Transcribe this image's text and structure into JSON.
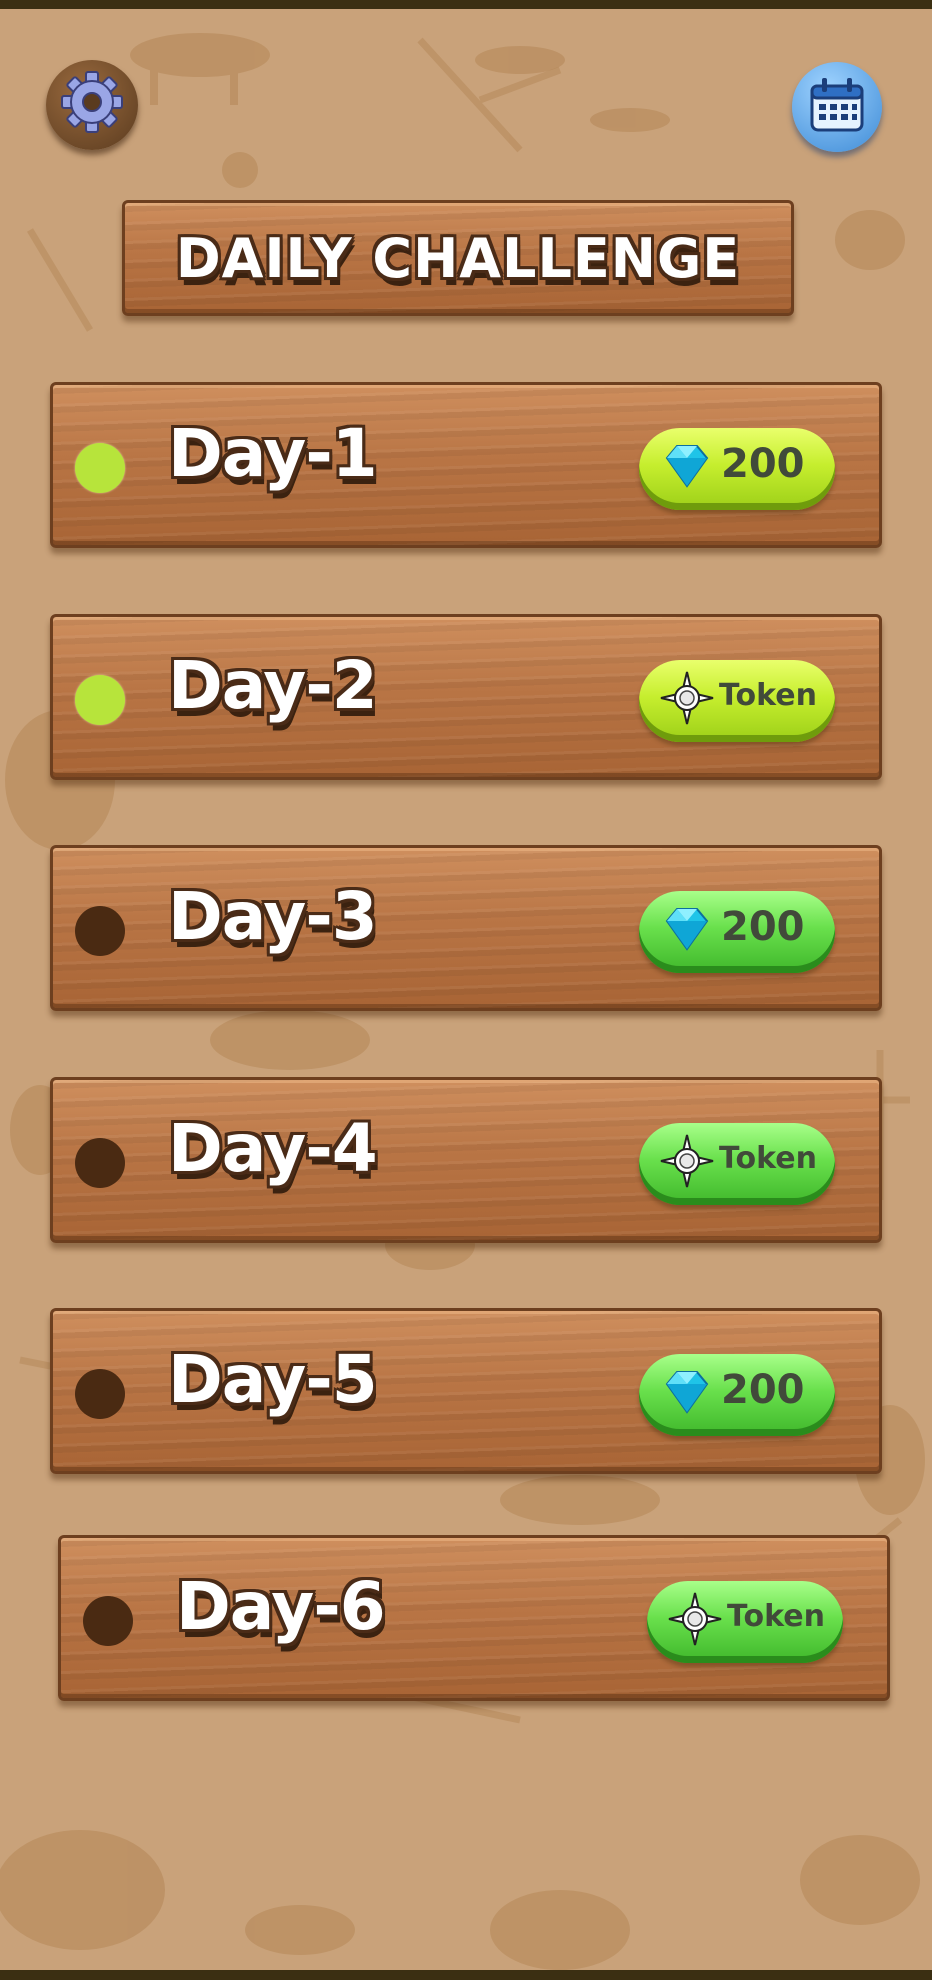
{
  "title": "DAILY CHALLENGE",
  "colors": {
    "background": "#c9a27a",
    "plank": "#b97545",
    "dot_active": "#b7e43b",
    "dot_inactive": "#4a2a12",
    "reward_lime": "#c6ee2e",
    "reward_green": "#69e04c"
  },
  "top_buttons": {
    "settings_icon": "gear-icon",
    "calendar_icon": "calendar-icon"
  },
  "days": [
    {
      "label": "Day-1",
      "active": true,
      "reward_icon": "diamond-icon",
      "reward_text": "200",
      "button_style": "lime"
    },
    {
      "label": "Day-2",
      "active": true,
      "reward_icon": "token-icon",
      "reward_text": "Token",
      "button_style": "lime"
    },
    {
      "label": "Day-3",
      "active": false,
      "reward_icon": "diamond-icon",
      "reward_text": "200",
      "button_style": "green"
    },
    {
      "label": "Day-4",
      "active": false,
      "reward_icon": "token-icon",
      "reward_text": "Token",
      "button_style": "green"
    },
    {
      "label": "Day-5",
      "active": false,
      "reward_icon": "diamond-icon",
      "reward_text": "200",
      "button_style": "green"
    },
    {
      "label": "Day-6",
      "active": false,
      "reward_icon": "token-icon",
      "reward_text": "Token",
      "button_style": "green"
    }
  ]
}
